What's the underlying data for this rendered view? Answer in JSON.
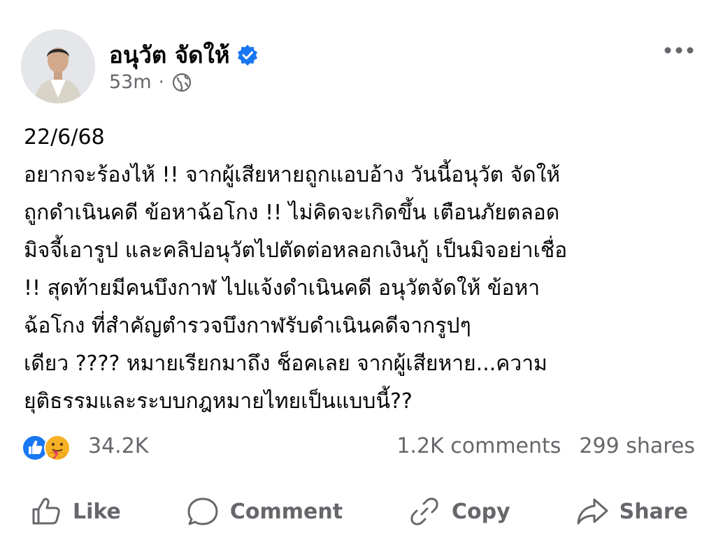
{
  "post": {
    "author": "อนุวัต จัดให้",
    "time": "53m",
    "separator": "·",
    "verified": true,
    "audience_icon": "globe-icon",
    "body_lines": [
      "22/6/68",
      "อยากจะร้องไห้ !! จากผู้เสียหายถูกแอบอ้าง วันนี้อนุวัต จัดให้",
      "ถูกดำเนินคดี ข้อหาฉ้อโกง !! ไม่คิดจะเกิดขึ้น เตือนภัยตลอด",
      "มิจจี้เอารูป และคลิปอนุวัตไปตัดต่อหลอกเงินกู้ เป็นมิจอย่าเชื่อ",
      "!! สุดท้ายมีคนบึงกาฬ ไปแจ้งดำเนินคดี อนุวัตจัดให้ ข้อหา",
      "ฉ้อโกง ที่สำคัญตำรวจบึงกาฬรับดำเนินคดีจากรูปๆ",
      "เดียว ???? หมายเรียกมาถึง ช็อคเลย จากผู้เสียหาย...ความ",
      "ยุติธรรมและระบบกฎหมายไทยเป็นแบบนี้??"
    ]
  },
  "engagement": {
    "reactions_count": "34.2K",
    "comments": "1.2K comments",
    "shares": "299 shares",
    "reaction_icons": [
      "like-icon",
      "care-icon"
    ]
  },
  "actions": {
    "like": "Like",
    "comment": "Comment",
    "copy": "Copy",
    "share": "Share"
  },
  "colors": {
    "accent": "#1877f2",
    "secondary_text": "#65676b",
    "text": "#050505",
    "care_yellow": "#f7b125"
  }
}
